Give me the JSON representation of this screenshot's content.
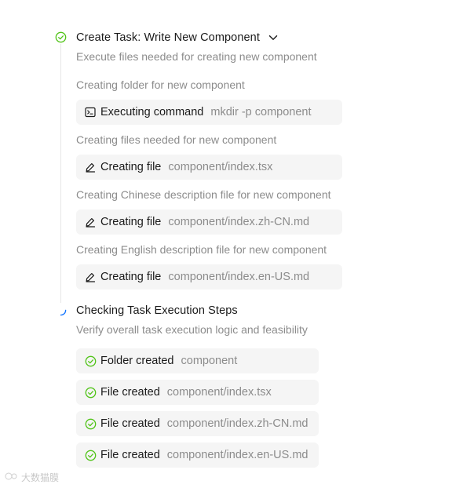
{
  "task": {
    "title": "Create Task: Write New Component",
    "description": "Execute files needed for creating new component",
    "steps": [
      {
        "label": "Creating folder for new component",
        "action": "Executing command",
        "arg": "mkdir -p component",
        "icon": "terminal-icon"
      },
      {
        "label": "Creating files needed for new component",
        "action": "Creating file",
        "arg": "component/index.tsx",
        "icon": "edit-icon"
      },
      {
        "label": "Creating Chinese description file for new component",
        "action": "Creating file",
        "arg": "component/index.zh-CN.md",
        "icon": "edit-icon"
      },
      {
        "label": "Creating English description file for new component",
        "action": "Creating file",
        "arg": "component/index.en-US.md",
        "icon": "edit-icon"
      }
    ]
  },
  "check": {
    "title": "Checking Task Execution Steps",
    "description": "Verify overall task execution logic and feasibility",
    "results": [
      {
        "action": "Folder created",
        "arg": "component",
        "icon": "check-circle-icon"
      },
      {
        "action": "File created",
        "arg": "component/index.tsx",
        "icon": "check-circle-icon"
      },
      {
        "action": "File created",
        "arg": "component/index.zh-CN.md",
        "icon": "check-circle-icon"
      },
      {
        "action": "File created",
        "arg": "component/index.en-US.md",
        "icon": "check-circle-icon"
      }
    ]
  },
  "watermark": "大数猫膜",
  "colors": {
    "success": "#52c41a",
    "loading": "#1677ff",
    "chip_bg": "#f5f5f5",
    "muted_text": "#8c8c8c"
  }
}
